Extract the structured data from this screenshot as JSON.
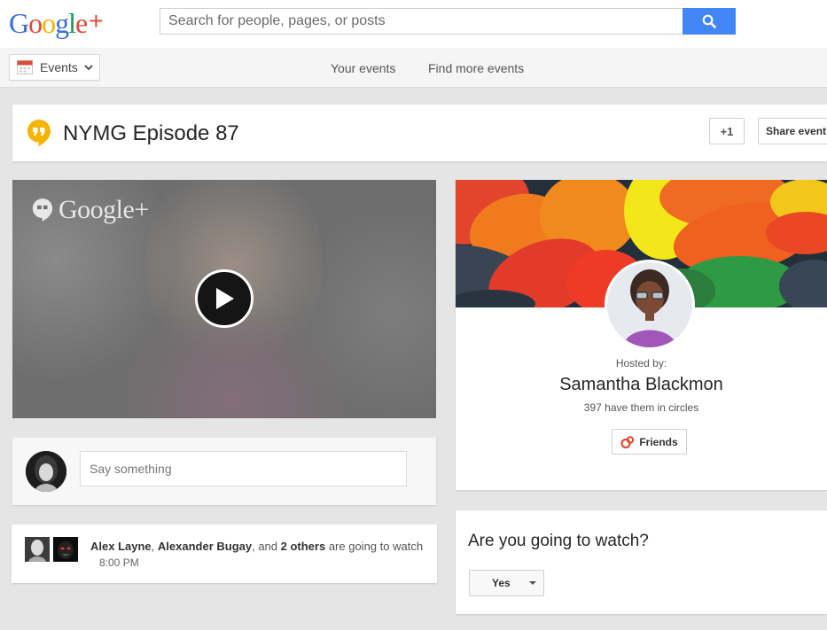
{
  "app": {
    "logo_letters": [
      "G",
      "o",
      "o",
      "g",
      "l",
      "e"
    ],
    "logo_plus": "+"
  },
  "search": {
    "placeholder": "Search for people, pages, or posts",
    "icon": "search-icon"
  },
  "subnav": {
    "dropdown_label": "Events",
    "links": [
      "Your events",
      "Find more events"
    ]
  },
  "event": {
    "title": "NYMG Episode 87",
    "plus_one_label": "+1",
    "share_label": "Share event"
  },
  "video": {
    "watermark": "Google+",
    "play_icon": "play-icon"
  },
  "comment": {
    "placeholder": "Say something"
  },
  "attendees": {
    "name1": "Alex Layne",
    "sep1": ", ",
    "name2": "Alexander Bugay",
    "sep2": ", and ",
    "others": "2 others",
    "suffix": " are going to watch",
    "time": "8:00 PM"
  },
  "host": {
    "hosted_label": "Hosted by:",
    "name": "Samantha Blackmon",
    "circles_text": "397 have them in circles",
    "friends_label": "Friends"
  },
  "rsvp": {
    "question": "Are you going to watch?",
    "selected": "Yes"
  },
  "colors": {
    "accent_blue": "#4285f4",
    "google_red": "#dd4b39",
    "hangouts_yellow": "#f4b400"
  }
}
